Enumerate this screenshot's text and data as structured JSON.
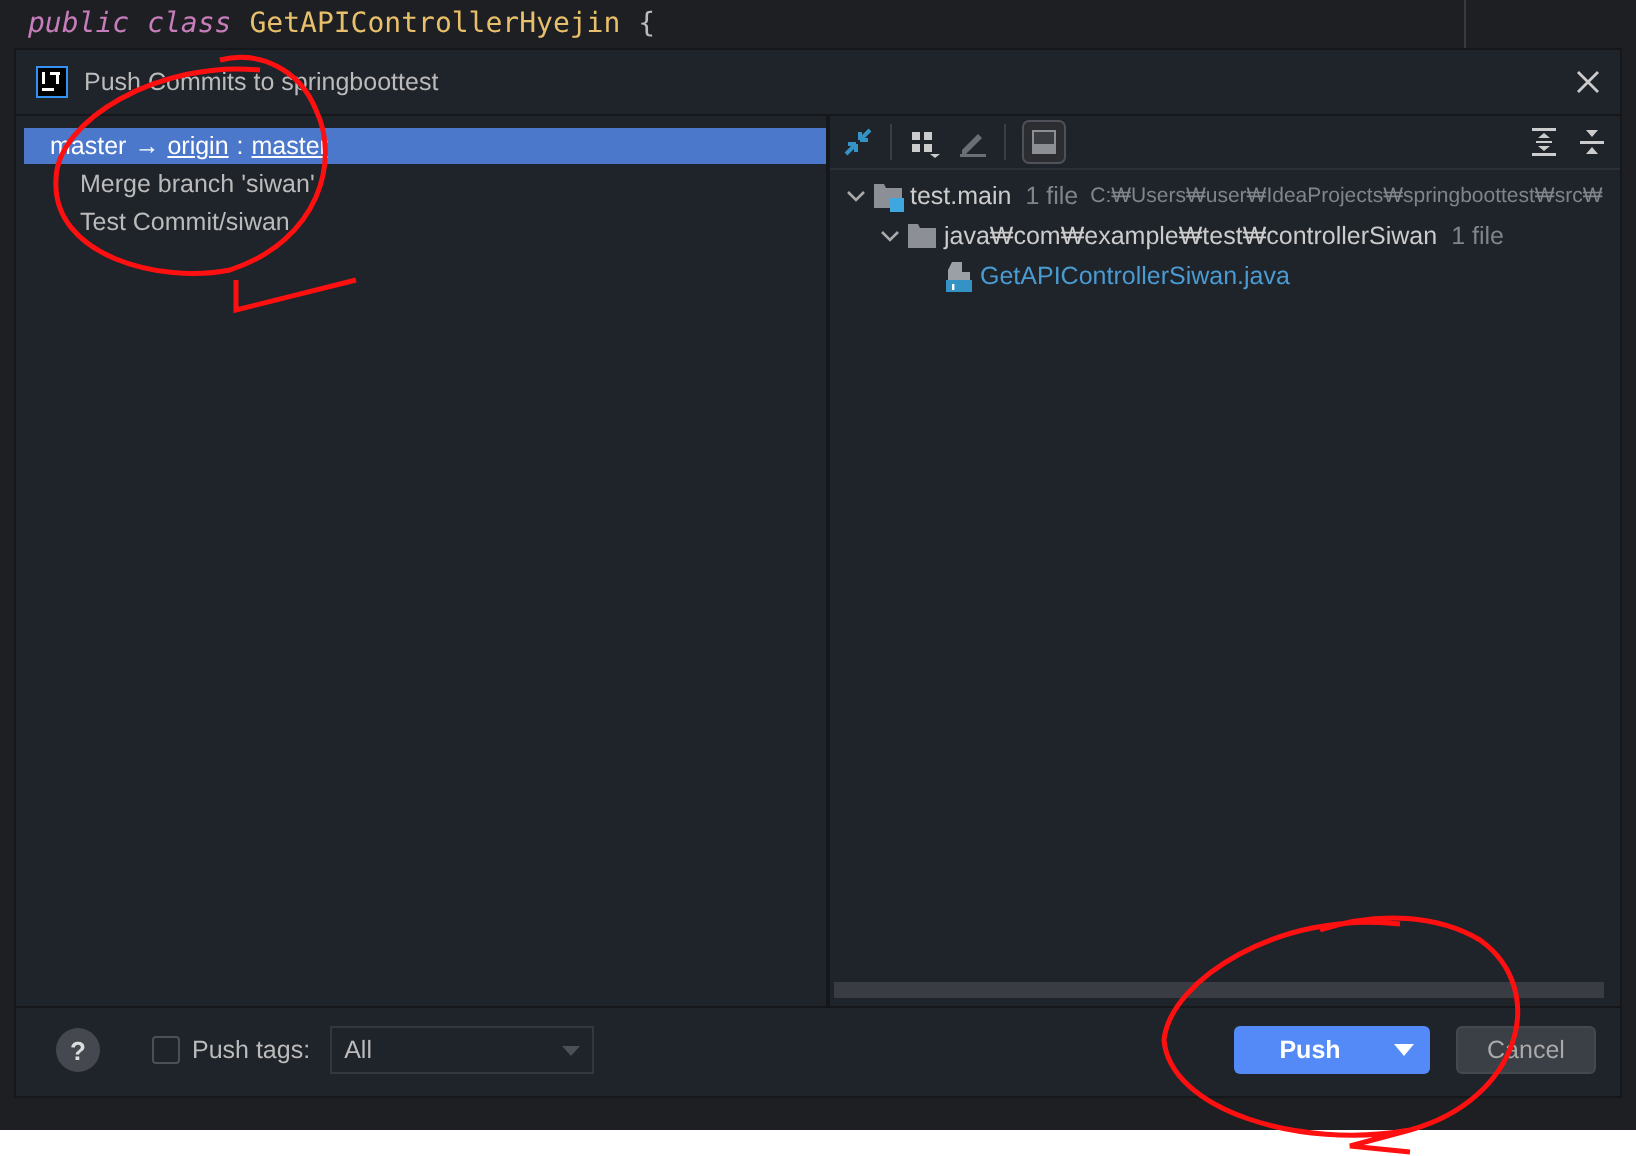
{
  "editor": {
    "code_line": [
      {
        "kind": "keyword",
        "text": "public"
      },
      {
        "kind": "keyword",
        "text": "class"
      },
      {
        "kind": "class",
        "text": "GetAPIControllerHyejin"
      },
      {
        "kind": "brace",
        "text": "{"
      }
    ]
  },
  "dialog": {
    "title": "Push Commits to springboottest",
    "branches": [
      {
        "local": "master",
        "arrow": "→",
        "remote": "origin",
        "separator": ":",
        "target": "master",
        "selected": true,
        "commits": [
          {
            "message": "Merge branch 'siwan'"
          },
          {
            "message": "Test Commit/siwan"
          }
        ]
      }
    ],
    "tree": [
      {
        "kind": "module",
        "name": "test.main",
        "count": "1 file",
        "path": "C:₩Users₩user₩IdeaProjects₩springboottest₩src₩",
        "expanded": true,
        "children": [
          {
            "kind": "folder",
            "name": "java₩com₩example₩test₩controllerSiwan",
            "count": "1 file",
            "expanded": true,
            "children": [
              {
                "kind": "file",
                "name": "GetAPIControllerSiwan.java"
              }
            ]
          }
        ]
      }
    ],
    "footer": {
      "help": "?",
      "push_tags": {
        "label": "Push tags:",
        "checked": false
      },
      "tags_dropdown": {
        "value": "All"
      },
      "buttons": [
        {
          "kind": "primary",
          "label": "Push"
        },
        {
          "kind": "secondary",
          "label": "Cancel"
        }
      ]
    }
  },
  "annotations": [
    {
      "kind": "circle"
    },
    {
      "kind": "circle"
    }
  ]
}
